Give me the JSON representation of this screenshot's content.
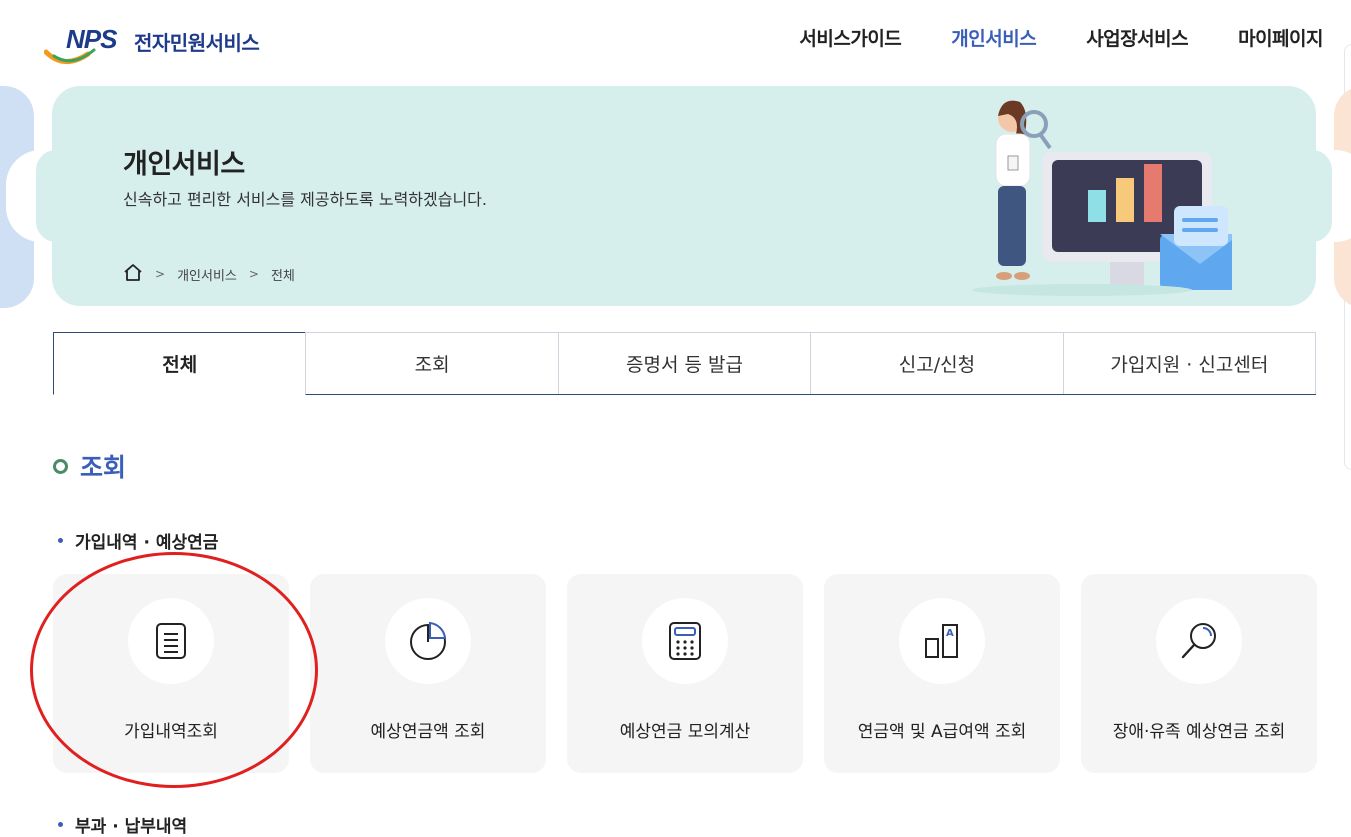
{
  "header": {
    "logo_mark": "NPS",
    "logo_title": "전자민원서비스",
    "nav": [
      "서비스가이드",
      "개인서비스",
      "사업장서비스",
      "마이페이지"
    ],
    "active_nav": "개인서비스"
  },
  "banner": {
    "title": "개인서비스",
    "subtitle": "신속하고 편리한 서비스를 제공하도록 노력하겠습니다.",
    "breadcrumb": [
      "개인서비스",
      "전체"
    ]
  },
  "tabs": [
    "전체",
    "조회",
    "증명서 등 발급",
    "신고/신청",
    "가입지원 · 신고센터"
  ],
  "section": {
    "title": "조회",
    "subsection_title": "가입내역 · 예상연금",
    "cards": [
      {
        "label": "가입내역조회",
        "icon": "document-icon"
      },
      {
        "label": "예상연금액 조회",
        "icon": "pie-chart-icon"
      },
      {
        "label": "예상연금 모의계산",
        "icon": "calculator-icon"
      },
      {
        "label": "연금액 및 A급여액 조회",
        "icon": "bar-a-icon"
      },
      {
        "label": "장애·유족 예상연금 조회",
        "icon": "magnifier-icon"
      }
    ],
    "next_subsection_title": "부과 · 납부내역"
  },
  "colors": {
    "brand": "#1e3a8a",
    "accent": "#3b5fb8",
    "banner_bg": "#d6efec",
    "highlight_ring": "#e0201f"
  }
}
